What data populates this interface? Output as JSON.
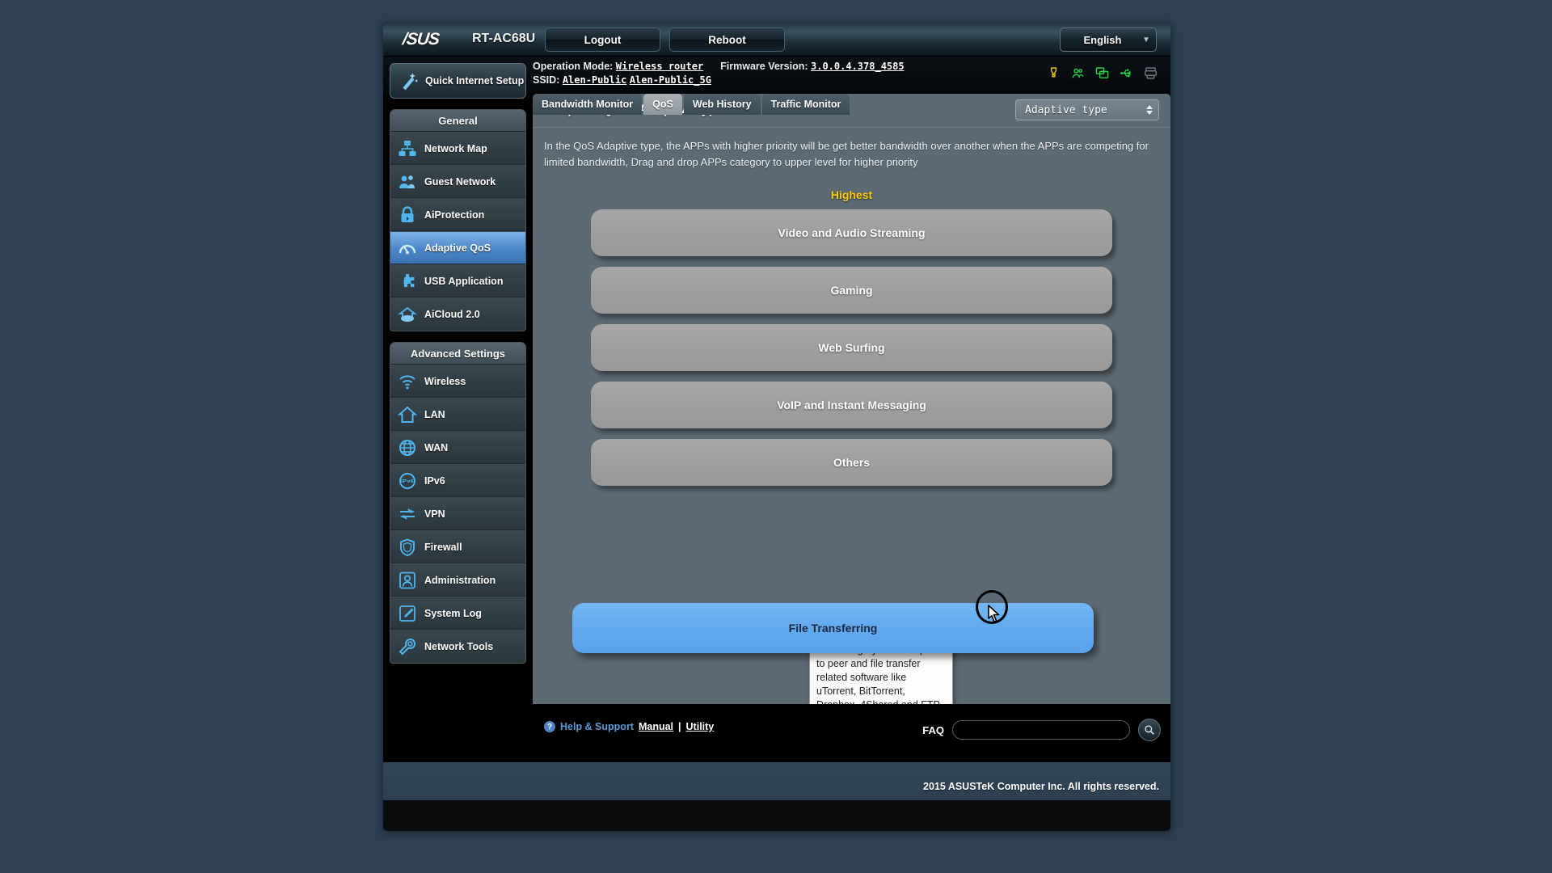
{
  "header": {
    "brand": "/SUS",
    "model": "RT-AC68U",
    "logout_label": "Logout",
    "reboot_label": "Reboot",
    "language": "English",
    "status_icons": [
      "alert-icon",
      "guest-user-icon",
      "monitor-icon",
      "usb-icon",
      "printer-icon"
    ]
  },
  "info": {
    "operation_mode_label": "Operation Mode:",
    "operation_mode_value": "Wireless router",
    "firmware_label": "Firmware Version:",
    "firmware_value": "3.0.0.4.378_4585",
    "ssid_label": "SSID:",
    "ssid_value_1": "Alen-Public",
    "ssid_value_2": "Alen-Public_5G"
  },
  "tabs": [
    {
      "label": "Bandwidth Monitor",
      "active": false
    },
    {
      "label": "QoS",
      "active": true
    },
    {
      "label": "Web History",
      "active": false
    },
    {
      "label": "Traffic Monitor",
      "active": false
    }
  ],
  "sidebar": {
    "quick_setup": "Quick Internet Setup",
    "groups": [
      {
        "title": "General",
        "items": [
          {
            "label": "Network Map",
            "icon": "network-map-icon",
            "active": false
          },
          {
            "label": "Guest Network",
            "icon": "guest-network-icon",
            "active": false
          },
          {
            "label": "AiProtection",
            "icon": "lock-icon",
            "active": false
          },
          {
            "label": "Adaptive QoS",
            "icon": "gauge-icon",
            "active": true
          },
          {
            "label": "USB Application",
            "icon": "puzzle-icon",
            "active": false
          },
          {
            "label": "AiCloud 2.0",
            "icon": "cloud-home-icon",
            "active": false
          }
        ]
      },
      {
        "title": "Advanced Settings",
        "items": [
          {
            "label": "Wireless",
            "icon": "wifi-icon",
            "active": false
          },
          {
            "label": "LAN",
            "icon": "home-icon",
            "active": false
          },
          {
            "label": "WAN",
            "icon": "globe-icon",
            "active": false
          },
          {
            "label": "IPv6",
            "icon": "ipv6-globe-icon",
            "active": false
          },
          {
            "label": "VPN",
            "icon": "vpn-arrows-icon",
            "active": false
          },
          {
            "label": "Firewall",
            "icon": "shield-icon",
            "active": false
          },
          {
            "label": "Administration",
            "icon": "user-admin-icon",
            "active": false
          },
          {
            "label": "System Log",
            "icon": "pencil-note-icon",
            "active": false
          },
          {
            "label": "Network Tools",
            "icon": "wrench-icon",
            "active": false
          }
        ]
      }
    ]
  },
  "main": {
    "title": "Adaptive QoS - Adaptive type",
    "type_select_value": "Adaptive type",
    "description": "In the QoS Adaptive type, the APPs with higher priority will be get better bandwidth over another when the APPs are competing for limited bandwidth, Drag and drop APPs category to upper level for higher priority",
    "highest_label": "Highest",
    "categories": [
      {
        "label": "Video and Audio Streaming",
        "state": "normal"
      },
      {
        "label": "Gaming",
        "state": "normal"
      },
      {
        "label": "Web Surfing",
        "state": "normal"
      },
      {
        "label": "VoIP and Instant Messaging",
        "state": "normal"
      },
      {
        "label": "Others",
        "state": "normal"
      }
    ],
    "dragging_category": {
      "label": "File Transferring",
      "state": "dragging"
    },
    "tooltip": "This category includes peer to peer and file transfer related software like uTorrent, BitTorrent, Dropbox, 4Shared and FTP applications,etc. It is recommended to leave file transfer category at a lower priority."
  },
  "footer": {
    "help_support": "Help & Support",
    "manual": "Manual",
    "separator": "|",
    "utility": "Utility",
    "faq_label": "FAQ",
    "faq_value": "",
    "faq_placeholder": "",
    "copyright": "2015 ASUSTeK Computer Inc. All rights reserved."
  },
  "colors": {
    "page_bg": "#2d4153",
    "panel_bg": "#5c6a74",
    "accent_blue": "#5aa3ec",
    "highest_yellow": "#ffcc00",
    "active_nav": "#4a86c8"
  }
}
